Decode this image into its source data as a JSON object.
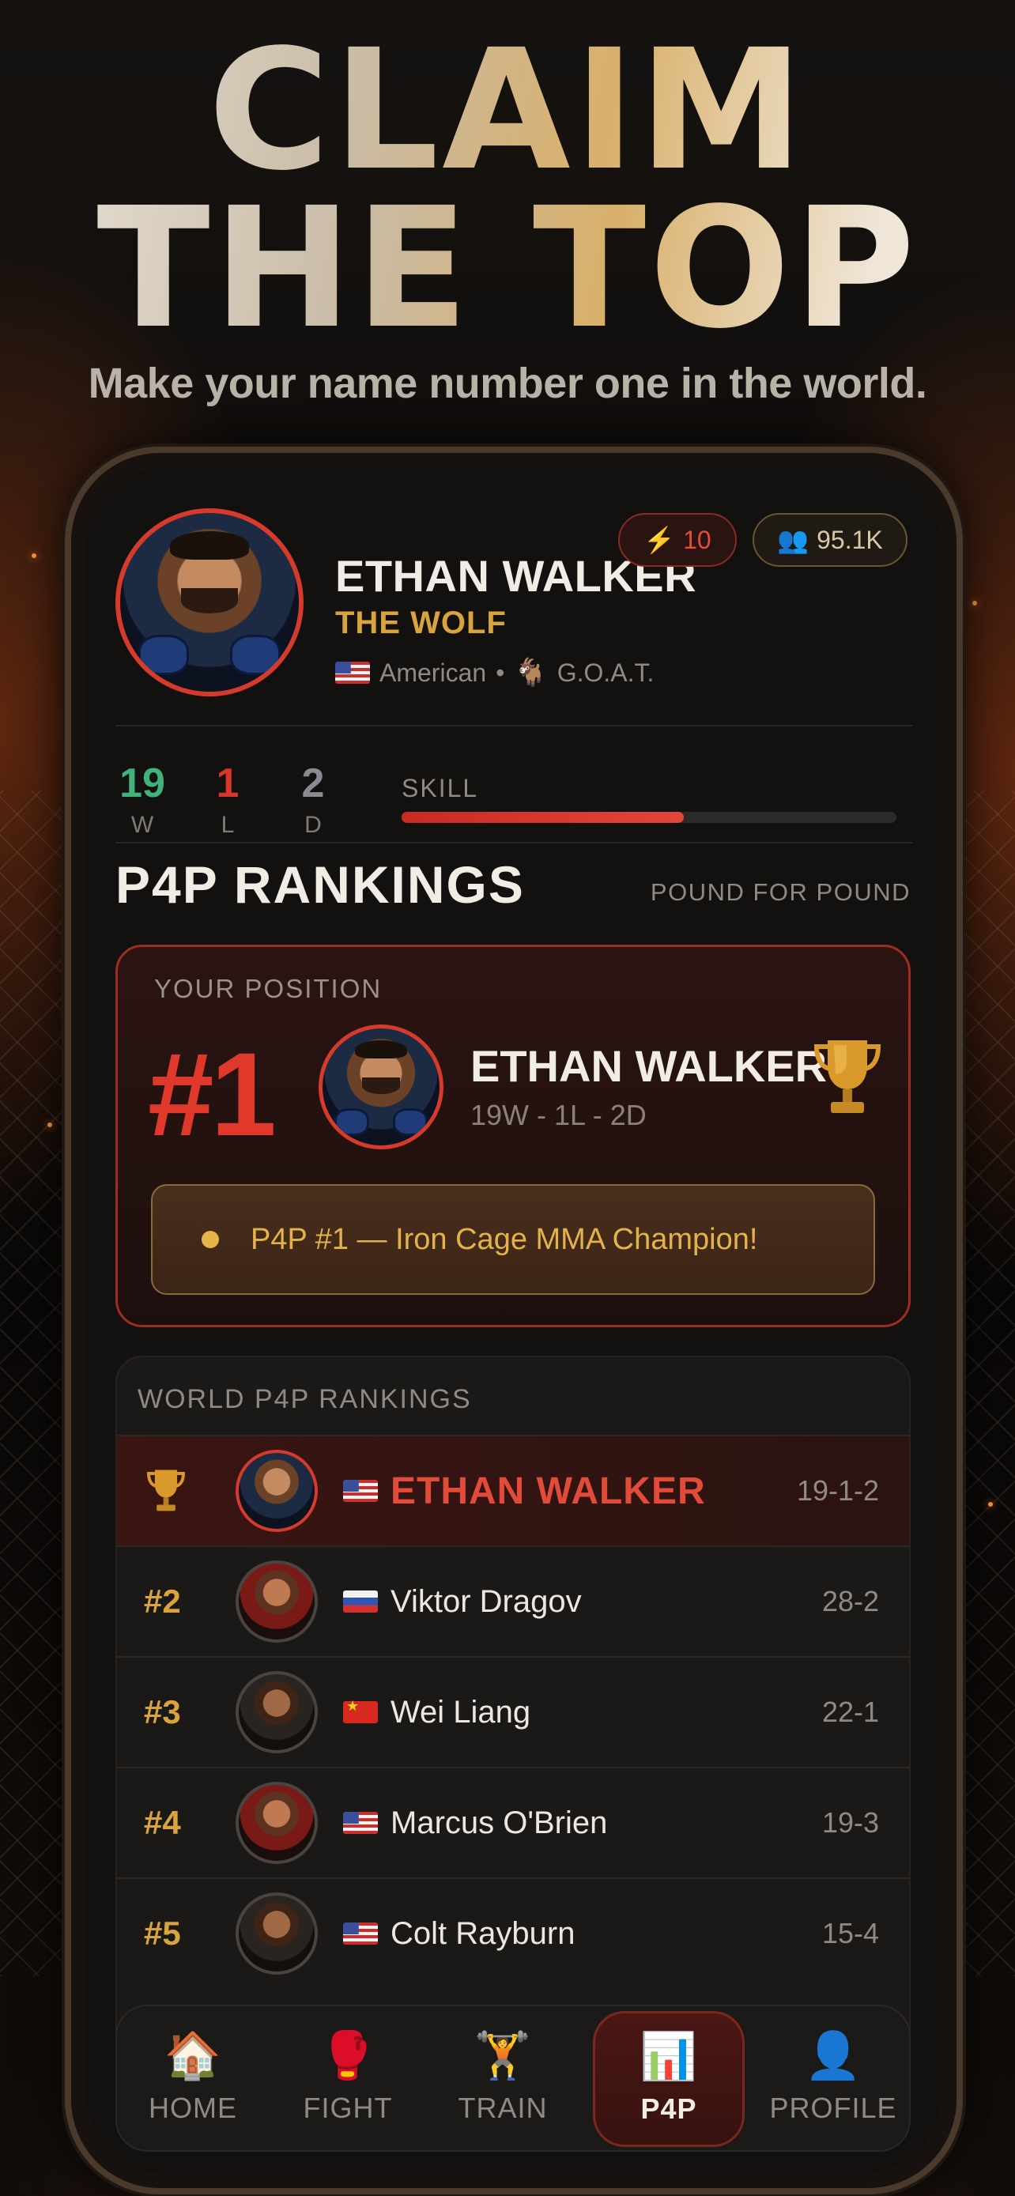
{
  "hero": {
    "line1": "CLAIM",
    "line2": "THE TOP",
    "subtitle": "Make your name number one in the world."
  },
  "profile": {
    "name": "ETHAN WALKER",
    "nickname": "THE WOLF",
    "nationality": "American",
    "separator": "•",
    "title": "G.O.A.T.",
    "energy": "10",
    "fans": "95.1K",
    "record": {
      "wins": "19",
      "losses": "1",
      "draws": "2",
      "w_label": "W",
      "l_label": "L",
      "d_label": "D"
    },
    "skill_label": "SKILL",
    "skill_level": 0.57
  },
  "rankings": {
    "title": "P4P RANKINGS",
    "subtitle": "POUND FOR POUND",
    "your_position_label": "YOUR POSITION",
    "your_rank": "#1",
    "your_name": "ETHAN WALKER",
    "your_record": "19W - 1L - 2D",
    "champion_text": "P4P #1 — Iron Cage MMA Champion!"
  },
  "world": {
    "title": "WORLD P4P RANKINGS",
    "rows": [
      {
        "rank": "",
        "name": "ETHAN WALKER",
        "record": "19-1-2",
        "flag": "us"
      },
      {
        "rank": "#2",
        "name": "Viktor Dragov",
        "record": "28-2",
        "flag": "ru"
      },
      {
        "rank": "#3",
        "name": "Wei Liang",
        "record": "22-1",
        "flag": "cn"
      },
      {
        "rank": "#4",
        "name": "Marcus O'Brien",
        "record": "19-3",
        "flag": "us"
      },
      {
        "rank": "#5",
        "name": "Colt Rayburn",
        "record": "15-4",
        "flag": "us"
      }
    ]
  },
  "nav": {
    "items": [
      {
        "label": "HOME",
        "icon": "house-icon",
        "glyph": "🏠"
      },
      {
        "label": "FIGHT",
        "icon": "boxing-glove-icon",
        "glyph": "🥊"
      },
      {
        "label": "TRAIN",
        "icon": "weightlifter-icon",
        "glyph": "🏋"
      },
      {
        "label": "P4P",
        "icon": "bar-chart-icon",
        "glyph": "📊"
      },
      {
        "label": "PROFILE",
        "icon": "person-icon",
        "glyph": "👤"
      }
    ],
    "active": "P4P"
  },
  "colors": {
    "accent_red": "#e0382b",
    "gold": "#d9a43c",
    "win_green": "#3fb37a",
    "loss_red": "#d8352b"
  }
}
